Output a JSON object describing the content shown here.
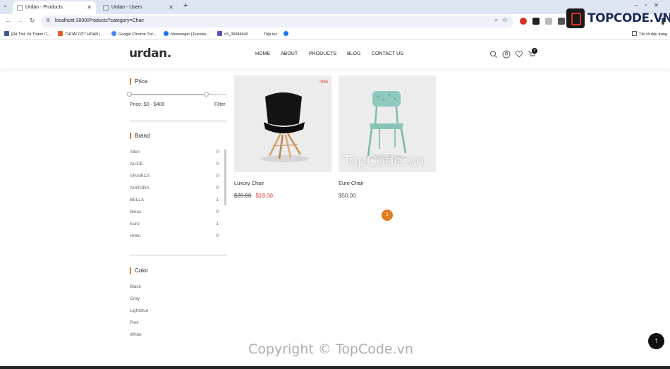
{
  "browser": {
    "tabs": [
      {
        "label": "Urdan - Products",
        "active": true
      },
      {
        "label": "Urdan - Users",
        "active": false
      }
    ],
    "url": "localhost:3000/Products?category=Chair",
    "bookmarks": [
      {
        "label": "[Đã Thử Và Thành C...",
        "color": "#3b5998"
      },
      {
        "label": "THOÁI CỐT HOAN |...",
        "color": "#e05a2b"
      },
      {
        "label": "Google Chrome Trợ...",
        "color": "#4285f4"
      },
      {
        "label": "Messenger | Facebo...",
        "color": "#1877f2"
      },
      {
        "label": "#3_35684640",
        "color": "#6a4bc4"
      },
      {
        "label": "Tiếp tục",
        "color": "#ffffff"
      },
      {
        "label": "",
        "color": "#1877f2"
      }
    ],
    "bookmarks_folder": "Tất cả dấu trang",
    "watermark_logo": "TOPCODE.VN"
  },
  "site": {
    "brand": "urdan.",
    "nav": [
      "HOME",
      "ABOUT",
      "PRODUCTS",
      "BLOG",
      "CONTACT US"
    ],
    "cart_count": "0"
  },
  "sidebar": {
    "price_title": "Price",
    "price_range": "Price: $0 - $400",
    "filter_label": "Filter",
    "price_slider": {
      "min": 0,
      "max": 400
    },
    "brand_title": "Brand",
    "brands": [
      {
        "name": "Allen",
        "count": "0"
      },
      {
        "name": "ALICE",
        "count": "0"
      },
      {
        "name": "ARABICA",
        "count": "0"
      },
      {
        "name": "AURORA",
        "count": "0"
      },
      {
        "name": "BELLA",
        "count": "1"
      },
      {
        "name": "Binas",
        "count": "0"
      },
      {
        "name": "Euro",
        "count": "1"
      },
      {
        "name": "Hobu",
        "count": "0"
      }
    ],
    "color_title": "Color",
    "colors": [
      "Black",
      "Gray",
      "Lightblue",
      "Pink",
      "White"
    ]
  },
  "products": [
    {
      "name": "Luxury Chair",
      "old_price": "$20.00",
      "price": "$19.00",
      "badge": "-5%"
    },
    {
      "name": "Euro Chair",
      "old_price": "",
      "price": "$50.00",
      "badge": ""
    }
  ],
  "pagination": {
    "current": "1"
  },
  "watermarks": {
    "mid": "TopCode.vn",
    "footer": "Copyright © TopCode.vn"
  },
  "colors": {
    "accent": "#e07b1e",
    "sale": "#ee3333"
  }
}
